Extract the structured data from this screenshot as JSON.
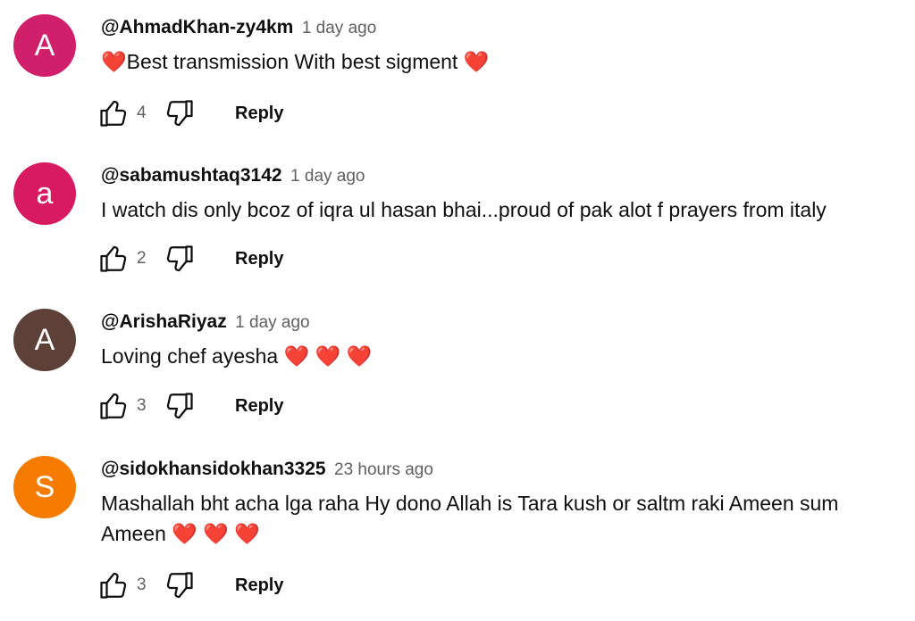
{
  "comments": [
    {
      "initial": "A",
      "avatar_color": "#d01f6b",
      "author": "@AhmadKhan-zy4km",
      "time": "1 day ago",
      "text": "❤️Best transmission With best sigment ❤️",
      "likes": "4",
      "reply_label": "Reply"
    },
    {
      "initial": "a",
      "avatar_color": "#d81b60",
      "author": "@sabamushtaq3142",
      "time": "1 day ago",
      "text": "I watch dis only bcoz of iqra ul hasan bhai...proud of pak alot f prayers from italy",
      "likes": "2",
      "reply_label": "Reply"
    },
    {
      "initial": "A",
      "avatar_color": "#5d4037",
      "author": "@ArishaRiyaz",
      "time": "1 day ago",
      "text": "Loving chef ayesha ❤️ ❤️ ❤️",
      "likes": "3",
      "reply_label": "Reply"
    },
    {
      "initial": "S",
      "avatar_color": "#f57c00",
      "author": "@sidokhansidokhan3325",
      "time": "23 hours ago",
      "text": "Mashallah bht acha lga raha Hy dono Allah is Tara kush or saltm raki Ameen sum Ameen ❤️ ❤️ ❤️",
      "likes": "3",
      "reply_label": "Reply"
    }
  ],
  "icons": {
    "like": "thumbs-up-icon",
    "dislike": "thumbs-down-icon"
  }
}
